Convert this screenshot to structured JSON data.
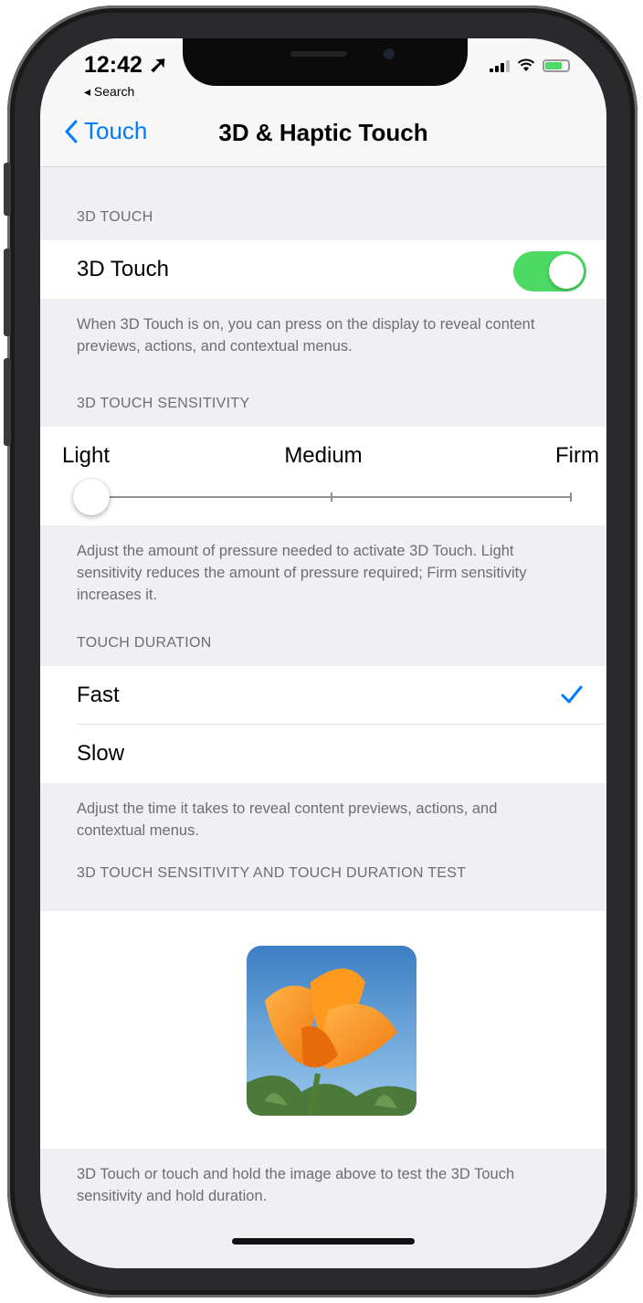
{
  "status": {
    "time": "12:42 ➚",
    "back_app": "◂ Search"
  },
  "nav": {
    "back_label": "Touch",
    "title": "3D & Haptic Touch"
  },
  "section_3d_touch": {
    "header": "3D TOUCH",
    "toggle_label": "3D Touch",
    "toggle_on": true,
    "footer": "When 3D Touch is on, you can press on the display to reveal content previews, actions, and contextual menus."
  },
  "section_sensitivity": {
    "header": "3D TOUCH SENSITIVITY",
    "labels": [
      "Light",
      "Medium",
      "Firm"
    ],
    "selected": "Light",
    "footer": "Adjust the amount of pressure needed to activate 3D Touch. Light sensitivity reduces the amount of pressure required; Firm sensitivity increases it."
  },
  "section_duration": {
    "header": "TOUCH DURATION",
    "options": [
      "Fast",
      "Slow"
    ],
    "selected": "Fast",
    "footer": "Adjust the time it takes to reveal content previews, actions, and contextual menus."
  },
  "section_test": {
    "header": "3D TOUCH SENSITIVITY AND TOUCH DURATION TEST",
    "footer": "3D Touch or touch and hold the image above to test the 3D Touch sensitivity and hold duration."
  },
  "colors": {
    "accent": "#007aff",
    "toggle_on": "#4cd964"
  }
}
